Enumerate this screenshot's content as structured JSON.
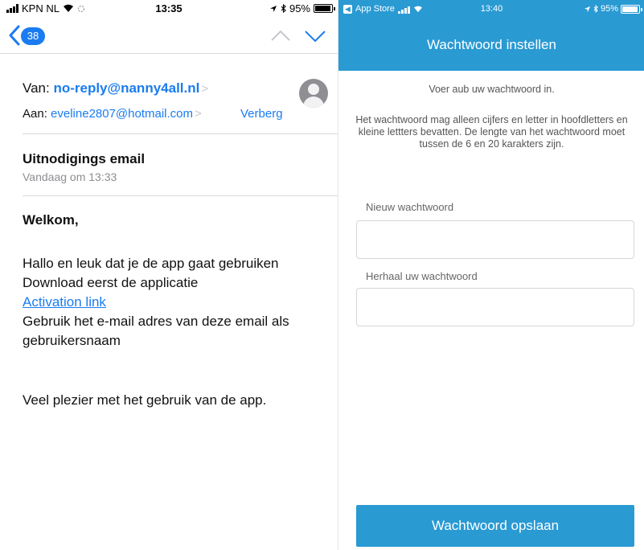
{
  "mail": {
    "status_bar": {
      "carrier": "KPN NL",
      "time": "13:35",
      "battery": "95%",
      "battery_level": 0.95
    },
    "nav": {
      "unread_count": "38"
    },
    "header": {
      "from_label": "Van:",
      "from_address": "no-reply@nanny4all.nl",
      "to_label": "Aan:",
      "to_address": "eveline2807@hotmail.com",
      "hide_label": "Verberg"
    },
    "subject": "Uitnodigings email",
    "date": "Vandaag om 13:33",
    "body": {
      "greeting": "Welkom,",
      "line1": "Hallo en leuk dat je de app gaat gebruiken",
      "line2": "Download eerst de applicatie",
      "link": "Activation link",
      "line3": "Gebruik het e-mail adres van deze email als gebruikersnaam",
      "closing": "Veel plezier met het gebruik van de app."
    }
  },
  "app": {
    "status_bar": {
      "back_app": "App Store",
      "time": "13:40",
      "battery": "95%",
      "battery_level": 0.95
    },
    "title": "Wachtwoord instellen",
    "intro": "Voer aub uw wachtwoord in.",
    "rules": "Het wachtwoord mag alleen cijfers en letter in hoofdletters en kleine lettters bevatten. De lengte van het wachtwoord moet tussen de 6 en 20 karakters zijn.",
    "new_password_label": "Nieuw wachtwoord",
    "repeat_password_label": "Herhaal uw wachtwoord",
    "save_label": "Wachtwoord opslaan"
  },
  "colors": {
    "ios_blue": "#1a7cf0",
    "app_blue": "#2a9ad3"
  }
}
